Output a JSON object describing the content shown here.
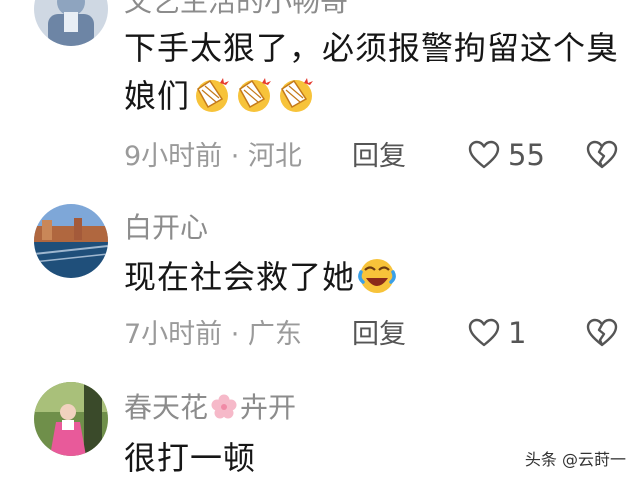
{
  "comments": [
    {
      "username": "文艺生活的小畅哥",
      "content": "下手太狠了，必须报警拘留这个臭娘们",
      "emoji_count": 3,
      "time_location": "9小时前 · 河北",
      "reply_label": "回复",
      "like_count": "55"
    },
    {
      "username": "白开心",
      "content": "现在社会救了她",
      "time_location": "7小时前 · 广东",
      "reply_label": "回复",
      "like_count": "1"
    },
    {
      "username_part1": "春天花",
      "username_part2": "卉开",
      "content": "很打一顿"
    }
  ],
  "watermark": "头条 @云莳一",
  "icons": {
    "like": "heart-outline-icon",
    "dislike": "broken-heart-icon",
    "slap_emoji": "slap-face-emoji-icon",
    "laugh_cry_emoji": "laugh-cry-emoji-icon",
    "flower": "cherry-blossom-icon"
  },
  "colors": {
    "meta": "#9a9a9a",
    "username": "#8c8c8c",
    "text": "#161616"
  }
}
